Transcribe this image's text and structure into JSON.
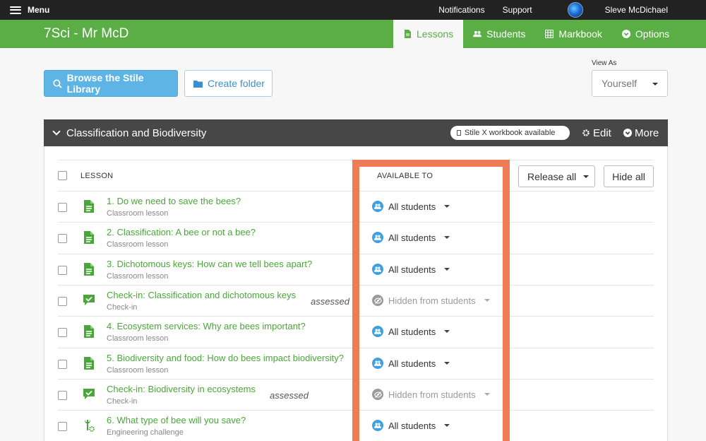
{
  "topbar": {
    "menu_label": "Menu",
    "notifications": "Notifications",
    "support": "Support",
    "user_name": "Sleve McDichael"
  },
  "course": {
    "title": "7Sci - Mr McD"
  },
  "tabs": [
    {
      "label": "Lessons",
      "icon": "document-icon",
      "active": true
    },
    {
      "label": "Students",
      "icon": "users-icon",
      "active": false
    },
    {
      "label": "Markbook",
      "icon": "grid-icon",
      "active": false
    },
    {
      "label": "Options",
      "icon": "chevron-circle-icon",
      "active": false
    }
  ],
  "actions": {
    "browse_label": "Browse the Stile Library",
    "folder_label": "Create folder",
    "view_as_label": "View As",
    "view_as_value": "Yourself"
  },
  "unit": {
    "title": "Classification and Biodiversity",
    "badge": "Stile X workbook available",
    "edit": "Edit",
    "more": "More",
    "col_lesson": "LESSON",
    "col_available": "AVAILABLE TO",
    "release_all": "Release all",
    "hide_all": "Hide all"
  },
  "lessons": [
    {
      "title": "1. Do we need to save the bees?",
      "type": "Classroom lesson",
      "icon": "document-icon",
      "availability": "All students",
      "assessed": ""
    },
    {
      "title": "2. Classification: A bee or not a bee?",
      "type": "Classroom lesson",
      "icon": "document-icon",
      "availability": "All students",
      "assessed": ""
    },
    {
      "title": "3. Dichotomous keys: How can we tell bees apart?",
      "type": "Classroom lesson",
      "icon": "document-icon",
      "availability": "All students",
      "assessed": ""
    },
    {
      "title": "Check-in: Classification and dichotomous keys",
      "type": "Check-in",
      "icon": "check-comment-icon",
      "availability": "Hidden from students",
      "assessed": "assessed"
    },
    {
      "title": "4. Ecosystem services: Why are bees important?",
      "type": "Classroom lesson",
      "icon": "document-icon",
      "availability": "All students",
      "assessed": ""
    },
    {
      "title": "5. Biodiversity and food: How do bees impact biodiversity?",
      "type": "Classroom lesson",
      "icon": "document-icon",
      "availability": "All students",
      "assessed": ""
    },
    {
      "title": "Check-in: Biodiversity in ecosystems",
      "type": "Check-in",
      "icon": "check-comment-icon",
      "availability": "Hidden from students",
      "assessed": "assessed"
    },
    {
      "title": "6. What type of bee will you save?",
      "type": "Engineering challenge",
      "icon": "wrench-gear-icon",
      "availability": "All students",
      "assessed": ""
    }
  ],
  "colors": {
    "brand_green": "#5aae45",
    "link_green": "#4aa63a",
    "accent_blue": "#5db4e5",
    "highlight": "#f07c55",
    "dark_header": "#474747"
  }
}
